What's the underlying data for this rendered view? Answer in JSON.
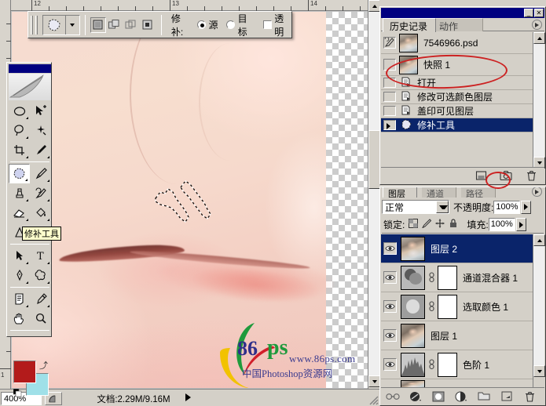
{
  "options_bar": {
    "tool_icon": "patch-tool-icon",
    "selection_modes": [
      "new-selection-icon",
      "add-to-selection-icon",
      "subtract-from-selection-icon",
      "intersect-selection-icon"
    ],
    "patch_label": "修补:",
    "source_label": "源",
    "destination_label": "目标",
    "transparent_label": "透明",
    "source_selected": true,
    "transparent_checked": false
  },
  "toolbox": {
    "tooltip": "修补工具",
    "foreground_color": "#b31b1b",
    "background_color": "#9fe0e8",
    "tools": [
      "marquee-tool-icon",
      "move-tool-icon",
      "lasso-tool-icon",
      "magic-wand-tool-icon",
      "crop-tool-icon",
      "slice-tool-icon",
      "patch-tool-icon",
      "brush-tool-icon",
      "clone-stamp-tool-icon",
      "history-brush-tool-icon",
      "eraser-tool-icon",
      "paint-bucket-tool-icon",
      "gradient-tool-icon",
      "blur-tool-icon",
      "path-selection-tool-icon",
      "type-tool-icon",
      "pen-tool-icon",
      "custom-shape-tool-icon",
      "notes-tool-icon",
      "eyedropper-tool-icon",
      "hand-tool-icon",
      "zoom-tool-icon"
    ],
    "selected_tool": "patch-tool-icon"
  },
  "document": {
    "ruler_top_labels": [
      "12",
      "13",
      "14"
    ],
    "ruler_left_labels": [
      "1"
    ],
    "watermark": {
      "mark": "86",
      "ps": "ps",
      "url": "www.86ps.com",
      "site": "中国Photoshop资源网"
    }
  },
  "status_bar": {
    "zoom_value": "400%",
    "doc_info": "文档:2.29M/9.16M"
  },
  "history_panel": {
    "tabs": [
      {
        "label": "历史记录",
        "active": true
      },
      {
        "label": "动作",
        "active": false
      }
    ],
    "minimize_glyph": "_",
    "close_glyph": "✕",
    "items": [
      {
        "label": "7546966.psd",
        "type": "snapshot",
        "thumb": "face",
        "selected": false,
        "brush_marker": true
      },
      {
        "label": "快照 1",
        "type": "snapshot",
        "thumb": "face",
        "selected": false,
        "highlighted": true
      },
      {
        "label": "打开",
        "type": "state",
        "selected": false
      },
      {
        "label": "修改可选颜色图层",
        "type": "state",
        "selected": false
      },
      {
        "label": "盖印可见图层",
        "type": "state",
        "selected": false
      },
      {
        "label": "修补工具",
        "type": "state",
        "selected": true
      }
    ],
    "footer_icons": [
      "new-document-from-state-icon",
      "new-snapshot-icon",
      "delete-state-icon"
    ],
    "highlighted_footer_icon": "new-snapshot-icon"
  },
  "layers_panel": {
    "tabs": [
      {
        "label": "图层",
        "active": true
      },
      {
        "label": "通道",
        "active": false
      },
      {
        "label": "路径",
        "active": false
      }
    ],
    "blend_mode": "正常",
    "opacity_label": "不透明度:",
    "opacity_value": "100%",
    "lock_label": "锁定:",
    "lock_icons": [
      "lock-transparent-icon",
      "lock-image-icon",
      "lock-position-icon",
      "lock-all-icon"
    ],
    "fill_label": "填充:",
    "fill_value": "100%",
    "layers": [
      {
        "name": "图层 2",
        "visible": true,
        "selected": true,
        "thumb": "face",
        "has_mask": false
      },
      {
        "name": "通道混合器 1",
        "visible": true,
        "selected": false,
        "thumb": "channel-mixer",
        "has_mask": true
      },
      {
        "name": "选取颜色 1",
        "visible": true,
        "selected": false,
        "thumb": "selective-color",
        "has_mask": true
      },
      {
        "name": "图层 1",
        "visible": true,
        "selected": false,
        "thumb": "face",
        "has_mask": false
      },
      {
        "name": "色阶 1",
        "visible": true,
        "selected": false,
        "thumb": "levels",
        "has_mask": true
      }
    ],
    "footer_icons": [
      "link-layers-icon",
      "layer-style-icon",
      "layer-mask-icon",
      "new-adjustment-layer-icon",
      "new-group-icon",
      "new-layer-icon",
      "delete-layer-icon"
    ]
  },
  "annotations": {
    "accent_color": "#cc2222",
    "ellipses": [
      "snapshot-1-highlight",
      "new-snapshot-button-highlight"
    ]
  }
}
